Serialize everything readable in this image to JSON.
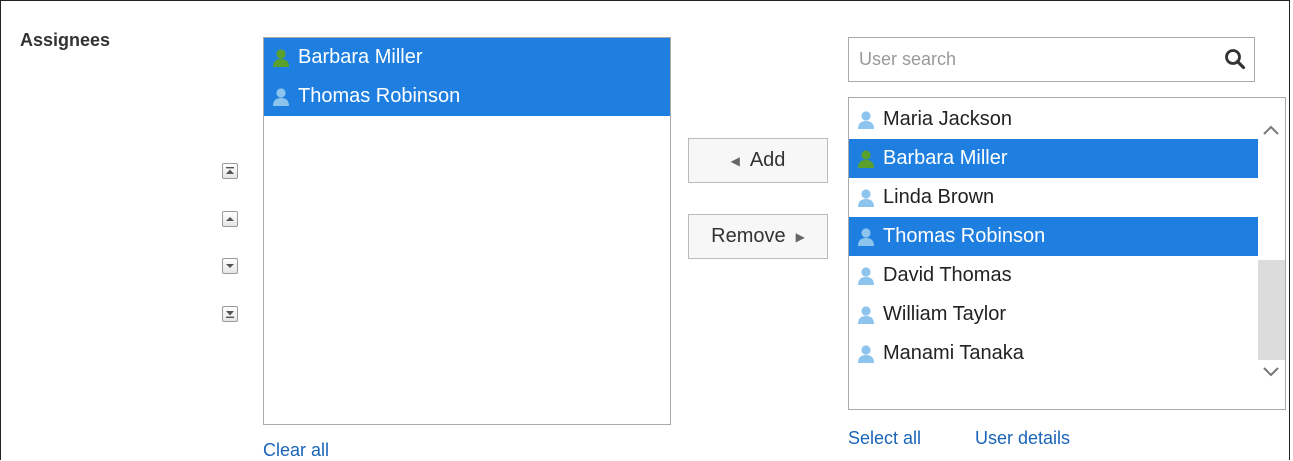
{
  "field_label": "Assignees",
  "selected_list": {
    "items": [
      {
        "name": "Barbara Miller",
        "icon": "user-icon-green",
        "selected": true
      },
      {
        "name": "Thomas Robinson",
        "icon": "user-icon-blue",
        "selected": true
      }
    ]
  },
  "order_buttons": [
    "move-to-top",
    "move-up",
    "move-down",
    "move-to-bottom"
  ],
  "actions": {
    "add_label": "Add",
    "remove_label": "Remove"
  },
  "links": {
    "clear_all": "Clear all",
    "select_all": "Select all",
    "user_details": "User details"
  },
  "search": {
    "placeholder": "User search",
    "value": ""
  },
  "candidate_list": {
    "items": [
      {
        "name": "Maria Jackson",
        "icon": "user-icon-blue",
        "selected": false
      },
      {
        "name": "Barbara Miller",
        "icon": "user-icon-green",
        "selected": true
      },
      {
        "name": "Linda Brown",
        "icon": "user-icon-blue",
        "selected": false
      },
      {
        "name": "Thomas Robinson",
        "icon": "user-icon-blue",
        "selected": true
      },
      {
        "name": "David Thomas",
        "icon": "user-icon-blue",
        "selected": false
      },
      {
        "name": "William Taylor",
        "icon": "user-icon-blue",
        "selected": false
      },
      {
        "name": "Manami Tanaka",
        "icon": "user-icon-blue",
        "selected": false
      }
    ]
  },
  "colors": {
    "selection": "#1e7fe0",
    "link": "#1a64b8",
    "user_blue": "#8dc4ee",
    "user_green": "#5aa02c"
  }
}
